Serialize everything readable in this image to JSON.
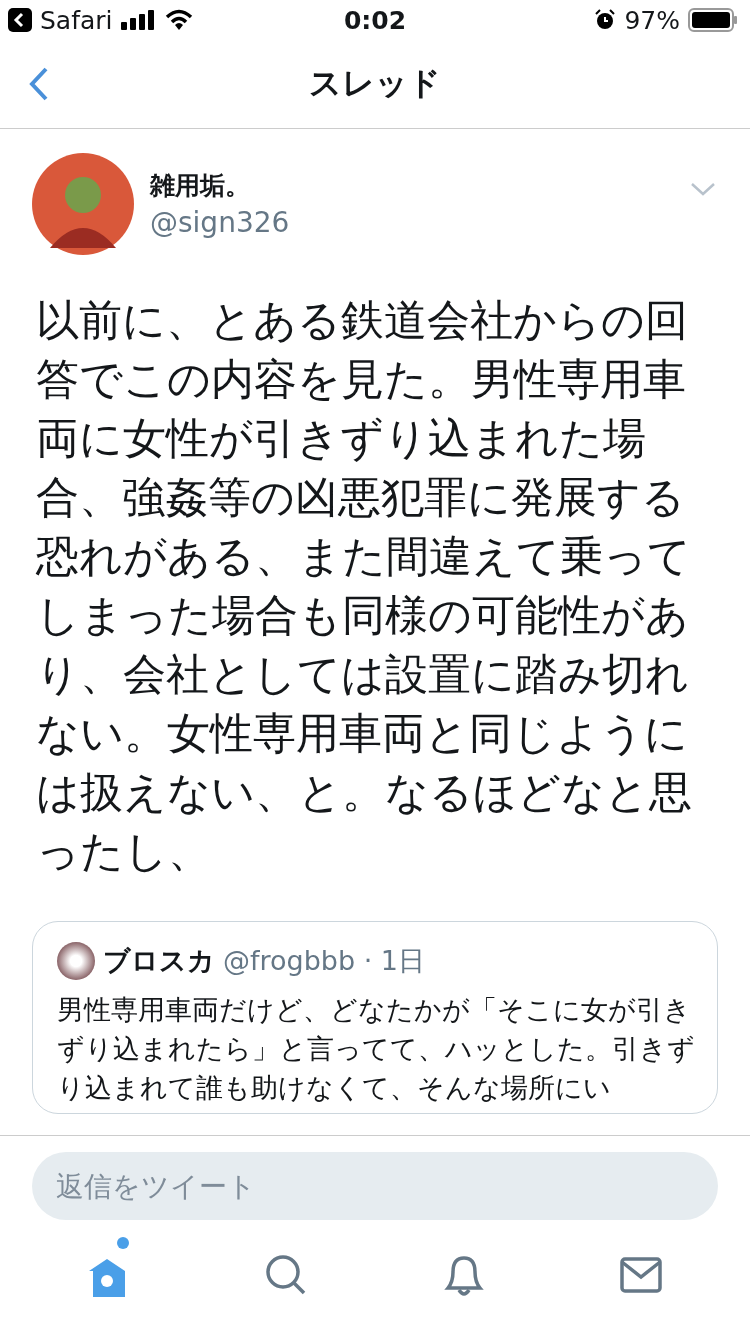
{
  "status_bar": {
    "back_app": "Safari",
    "time": "0:02",
    "battery": "97%"
  },
  "nav": {
    "title": "スレッド"
  },
  "tweet": {
    "name": "雑用垢。",
    "handle": "@sign326",
    "text": "以前に、とある鉄道会社からの回答でこの内容を見た。男性専用車両に女性が引きずり込まれた場合、強姦等の凶悪犯罪に発展する恐れがある、また間違えて乗ってしまった場合も同様の可能性があり、会社としては設置に踏み切れない。女性専用車両と同じようには扱えない、と。なるほどなと思ったし、"
  },
  "quote": {
    "name": "ブロスカ",
    "meta": "@frogbbb · 1日",
    "text": "男性専用車両だけど、どなたかが「そこに女が引きずり込まれたら」と言ってて、ハッとした。引きずり込まれて誰も助けなくて、そんな場所にい"
  },
  "reply": {
    "placeholder": "返信をツイート"
  },
  "tabs": [
    {
      "kind": "home",
      "selected": true,
      "badge": true
    },
    {
      "kind": "search",
      "selected": false,
      "badge": false
    },
    {
      "kind": "notifications",
      "selected": false,
      "badge": false
    },
    {
      "kind": "messages",
      "selected": false,
      "badge": false
    }
  ]
}
